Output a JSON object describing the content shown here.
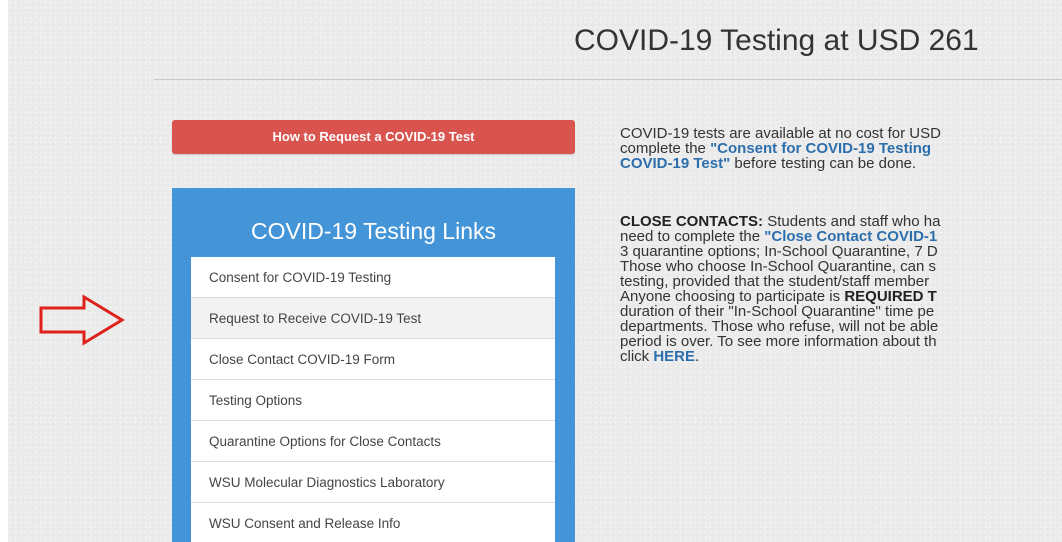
{
  "page_title": "COVID-19 Testing at USD 261",
  "request_button": "How to Request a COVID-19 Test",
  "links_panel": {
    "heading": "COVID-19 Testing Links",
    "items": [
      "Consent for COVID-19 Testing",
      "Request to Receive COVID-19 Test",
      "Close Contact COVID-19 Form",
      "Testing Options",
      "Quarantine Options for Close Contacts",
      "WSU Molecular Diagnostics Laboratory",
      "WSU Consent and Release Info"
    ]
  },
  "intro": {
    "line1": "COVID-19 tests are available at no cost for USD",
    "line2_prefix": "complete the ",
    "link_consent": "\"Consent for COVID-19 Testing",
    "link_request_tail": "COVID-19 Test\"",
    "line3_suffix": " before testing can be done."
  },
  "close_contacts": {
    "label": "CLOSE CONTACTS:",
    "line1_rest": " Students and staff who ha",
    "line2_prefix": "need to complete the ",
    "link_form": "\"Close Contact COVID-1",
    "line3": "3 quarantine options; In-School Quarantine, 7 D",
    "line4": "Those who choose In-School Quarantine, can s",
    "line5": "testing, provided that the student/staff member",
    "line6_prefix": "Anyone choosing to participate is ",
    "required": "REQUIRED T",
    "line7": "duration of their \"In-School Quarantine\" time pe",
    "line8": "departments. Those who refuse, will not be able",
    "line9": "period is over. To see more information about th",
    "line10_prefix": "click ",
    "here_link": "HERE",
    "line10_suffix": "."
  },
  "colors": {
    "request_button": "#d9534f",
    "links_panel": "#4494d8",
    "link_text": "#2d6fad",
    "arrow": "#e0201b"
  },
  "icons": {
    "annotation_arrow": "right-arrow-outline"
  }
}
